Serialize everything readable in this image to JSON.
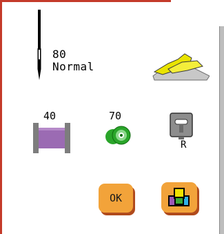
{
  "needle": {
    "size": "80",
    "type": "Normal",
    "icon": "sewing-needle-icon"
  },
  "presser_foot_button": {
    "icon": "presser-foot-icon"
  },
  "upper_thread": {
    "weight": "40",
    "icon": "thread-spool-icon",
    "color": "#9b6bb3"
  },
  "bobbin_thread": {
    "weight": "70",
    "icon": "bobbin-icon",
    "color": "#2aa52a"
  },
  "presser_foot": {
    "label": "R",
    "icon": "presser-foot-sole-icon"
  },
  "actions": {
    "ok_label": "OK",
    "color_button_icon": "color-blocks-icon",
    "accent": "#f2a33a",
    "accent_shadow": "#b04a1c"
  }
}
